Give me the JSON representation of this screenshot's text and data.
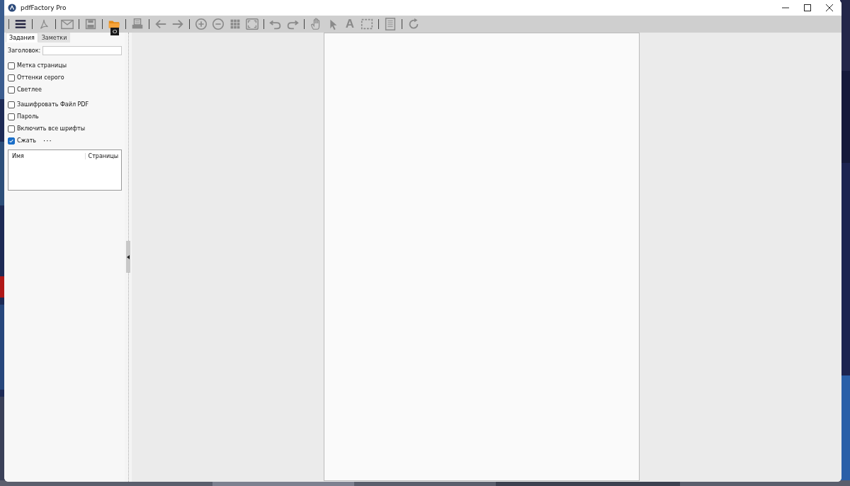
{
  "window": {
    "title": "pdfFactory Pro"
  },
  "toolbar": [
    {
      "kind": "separator"
    },
    {
      "kind": "menu"
    },
    {
      "kind": "separator"
    },
    {
      "kind": "pdf"
    },
    {
      "kind": "separator"
    },
    {
      "kind": "mail"
    },
    {
      "kind": "separator"
    },
    {
      "kind": "save"
    },
    {
      "kind": "separator"
    },
    {
      "kind": "folder",
      "tooltip": "O"
    },
    {
      "kind": "separator"
    },
    {
      "kind": "printer"
    },
    {
      "kind": "separator"
    },
    {
      "kind": "back"
    },
    {
      "kind": "forward"
    },
    {
      "kind": "separator"
    },
    {
      "kind": "zoom-in"
    },
    {
      "kind": "zoom-out"
    },
    {
      "kind": "grid"
    },
    {
      "kind": "fit"
    },
    {
      "kind": "separator"
    },
    {
      "kind": "undo"
    },
    {
      "kind": "redo"
    },
    {
      "kind": "separator"
    },
    {
      "kind": "hand"
    },
    {
      "kind": "pointer"
    },
    {
      "kind": "glyph",
      "text": "A"
    },
    {
      "kind": "select"
    },
    {
      "kind": "separator"
    },
    {
      "kind": "page"
    },
    {
      "kind": "separator"
    },
    {
      "kind": "refresh"
    }
  ],
  "tabs": [
    {
      "label": "Задания",
      "selected": true
    },
    {
      "label": "Заметки",
      "selected": false
    }
  ],
  "title_field": {
    "label": "Заголовок:"
  },
  "option_groups": [
    [
      {
        "label": "Метка страницы",
        "checked": false
      },
      {
        "label": "Оттенки серого",
        "checked": false
      },
      {
        "label": "Светлее",
        "checked": false
      }
    ],
    [
      {
        "label": "Зашифровать Файл PDF",
        "checked": false
      },
      {
        "label": "Пароль",
        "checked": false
      },
      {
        "label": "Включить все шрифты",
        "checked": false
      },
      {
        "label": "Сжать",
        "checked": true,
        "more": "···"
      }
    ]
  ],
  "table": {
    "columns": [
      "Имя",
      "Страницы"
    ]
  }
}
